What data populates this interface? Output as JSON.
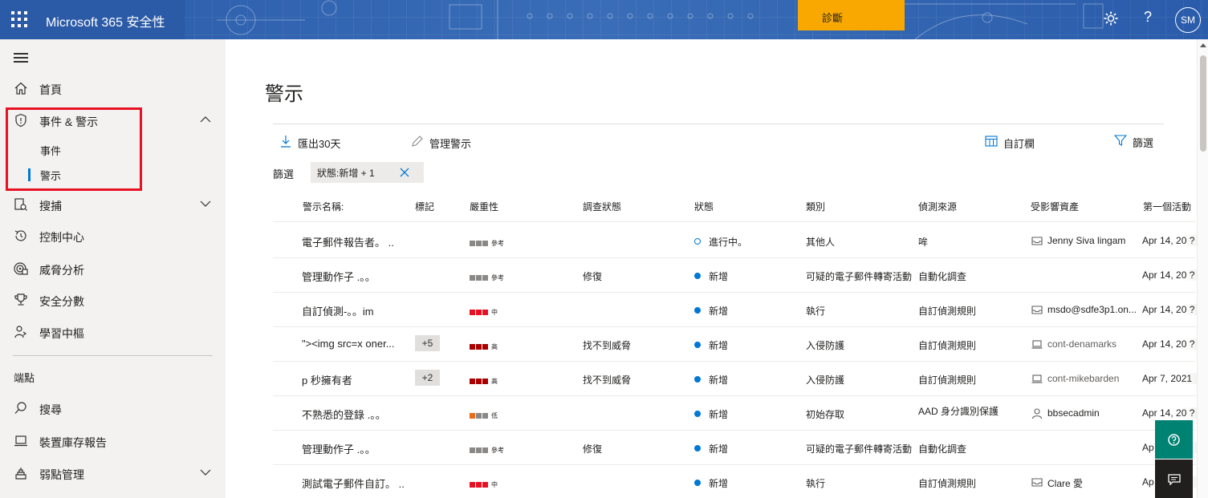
{
  "topbar": {
    "app_title": "Microsoft 365 安全性",
    "diagnose_label": "診斷",
    "help_glyph": "?",
    "avatar_initials": "SM",
    "colors": {
      "bar": "#2b5aa6",
      "diagnose": "#f8a800"
    }
  },
  "sidebar": {
    "items": [
      {
        "label": "首頁",
        "icon": "home-icon"
      },
      {
        "label": "事件 & 警示",
        "icon": "shield-icon",
        "expanded": true
      },
      {
        "label": "搜捕",
        "icon": "hunting-icon"
      },
      {
        "label": "控制中心",
        "icon": "action-center-icon"
      },
      {
        "label": "威脅分析",
        "icon": "threat-analytics-icon"
      },
      {
        "label": "安全分數",
        "icon": "trophy-icon"
      },
      {
        "label": "學習中樞",
        "icon": "learning-hub-icon"
      }
    ],
    "sub_items": [
      {
        "label": "事件"
      },
      {
        "label": "警示",
        "active": true
      }
    ],
    "section_label": "端點",
    "endpoint_items": [
      {
        "label": "搜尋",
        "icon": "search-icon"
      },
      {
        "label": "裝置庫存報告",
        "icon": "device-icon"
      },
      {
        "label": "弱點管理",
        "icon": "vulnerability-icon"
      }
    ]
  },
  "main": {
    "title": "警示",
    "commands": {
      "export": "匯出30天",
      "manage": "管理警示",
      "customize": "自訂欄",
      "filter": "篩選"
    },
    "filter_label": "篩選",
    "filter_chip": "狀態:新增 + 1",
    "columns": [
      "警示名稱:",
      "標記",
      "嚴重性",
      "調查狀態",
      "狀態",
      "類別",
      "偵測來源",
      "受影響資產",
      "第一個活動"
    ],
    "rows": [
      {
        "name": "電子郵件報告者。 ..",
        "tag": "",
        "severity": "參考",
        "sev_level": "info",
        "investigation": "",
        "status": "進行中。",
        "status_hollow": true,
        "category": "其他人",
        "source": "哞",
        "asset": "Jenny Siva lingam",
        "asset_type": "mailbox",
        "first_activity": "Apr 14, 20 ?"
      },
      {
        "name": "管理動作子 .。。",
        "tag": "",
        "severity": "參考",
        "sev_level": "info",
        "investigation": "修復",
        "status": "新增",
        "status_hollow": false,
        "category": "可疑的電子郵件轉寄活動",
        "source": "自動化調查",
        "asset": "",
        "asset_type": "",
        "first_activity": "Apr 14, 20 ?"
      },
      {
        "name": "自訂偵測-。。im",
        "tag": "",
        "severity": "中",
        "sev_level": "medium",
        "investigation": "",
        "status": "新增",
        "status_hollow": false,
        "category": "執行",
        "source": "自訂偵測規則",
        "asset": "msdo@sdfe3p1.on...",
        "asset_type": "mailbox",
        "first_activity": "Apr 14, 20 ?"
      },
      {
        "name": "\"><img src=x oner...",
        "tag": "+5",
        "severity": "高",
        "sev_level": "high",
        "investigation": "找不到威脅",
        "status": "新增",
        "status_hollow": false,
        "category": "入侵防護",
        "source": "自訂偵測規則",
        "asset": "cont-denamarks",
        "asset_type": "device",
        "first_activity": "Apr 14, 20 ?"
      },
      {
        "name": "p 秒擁有者",
        "tag": "+2",
        "severity": "高",
        "sev_level": "high",
        "investigation": "找不到威脅",
        "status": "新增",
        "status_hollow": false,
        "category": "入侵防護",
        "source": "自訂偵測規則",
        "asset": "cont-mikebarden",
        "asset_type": "device",
        "first_activity": "Apr 7, 2021"
      },
      {
        "name": "不熟悉的登錄 .。。",
        "tag": "",
        "severity": "低",
        "sev_level": "low",
        "investigation": "",
        "status": "新增",
        "status_hollow": false,
        "category": "初始存取",
        "source": "AAD 身分識別保護",
        "asset": "bbsecadmin",
        "asset_type": "user",
        "first_activity": "Apr 14, 20 ?"
      },
      {
        "name": "管理動作子 .。。",
        "tag": "",
        "severity": "參考",
        "sev_level": "info",
        "investigation": "修復",
        "status": "新增",
        "status_hollow": false,
        "category": "可疑的電子郵件轉寄活動",
        "source": "自動化調查",
        "asset": "",
        "asset_type": "",
        "first_activity": "Ap"
      },
      {
        "name": "測試電子郵件自訂。 ..",
        "tag": "",
        "severity": "中",
        "sev_level": "medium",
        "investigation": "",
        "status": "新增",
        "status_hollow": false,
        "category": "執行",
        "source": "自訂偵測規則",
        "asset": "Clare 愛",
        "asset_type": "mailbox",
        "first_activity": "Ap"
      }
    ]
  },
  "severity_colors": {
    "high": "#a80000",
    "medium": "#e81123",
    "low": "#ea6b1a",
    "info": "#8a8886",
    "empty": "#c8c6c4"
  }
}
